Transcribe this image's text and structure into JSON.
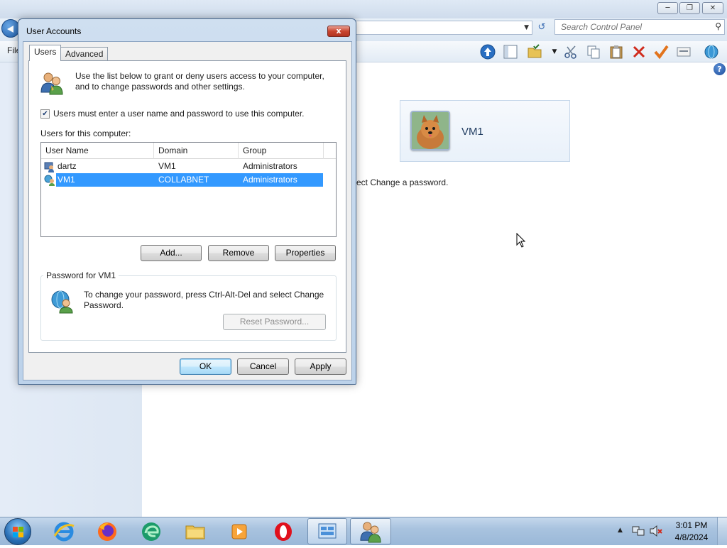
{
  "control_panel": {
    "search_placeholder": "Search Control Panel",
    "menu_file": "File",
    "user_tile_name": "VM1",
    "partial_text": "ect Change a password.",
    "help": "?"
  },
  "dialog": {
    "title": "User Accounts",
    "close": "x",
    "tabs": [
      "Users",
      "Advanced"
    ],
    "intro_text": "Use the list below to grant or deny users access to your computer, and to change passwords and other settings.",
    "must_enter_checkbox": {
      "label": "Users must enter a user name and password to use this computer.",
      "checked": true
    },
    "users_for_label": "Users for this computer:",
    "list_columns": [
      "User Name",
      "Domain",
      "Group"
    ],
    "users": [
      {
        "name": "dartz",
        "domain": "VM1",
        "group": "Administrators"
      },
      {
        "name": "VM1",
        "domain": "COLLABNET",
        "group": "Administrators",
        "selected": true
      }
    ],
    "buttons": {
      "add": "Add...",
      "remove": "Remove",
      "properties": "Properties"
    },
    "password_group": {
      "label": "Password for VM1",
      "text": "To change your password, press Ctrl-Alt-Del and select Change Password.",
      "reset_button": "Reset Password..."
    },
    "footer_buttons": {
      "ok": "OK",
      "cancel": "Cancel",
      "apply": "Apply"
    }
  },
  "taskbar": {
    "time": "3:01 PM",
    "date": "4/8/2024"
  },
  "colors": {
    "selection": "#3399ff",
    "taskbar": "#a9c3df"
  }
}
